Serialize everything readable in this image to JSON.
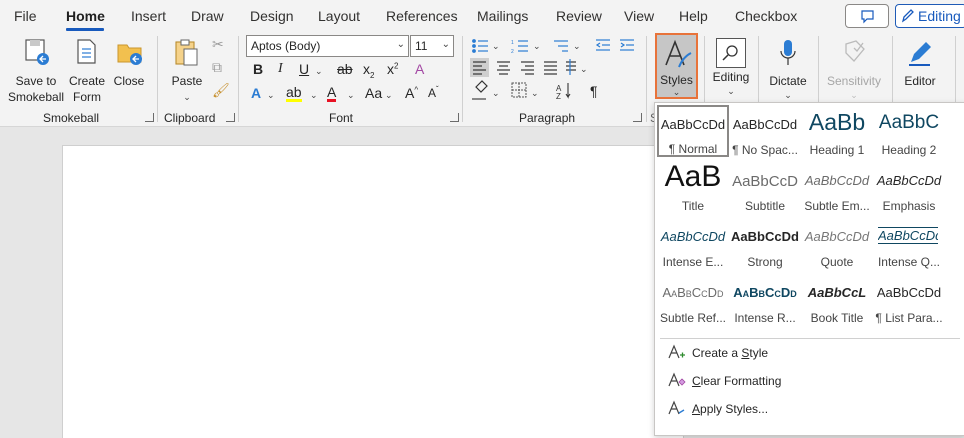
{
  "menu": {
    "tabs": [
      "File",
      "Home",
      "Insert",
      "Draw",
      "Design",
      "Layout",
      "References",
      "Mailings",
      "Review",
      "View",
      "Help",
      "Checkbox"
    ],
    "active_tab": "Home",
    "editing_button": "Editing"
  },
  "ribbon": {
    "smokeball": {
      "group_label": "Smokeball",
      "save_line1": "Save to",
      "save_line2": "Smokeball",
      "create_line1": "Create",
      "create_line2": "Form",
      "close": "Close"
    },
    "clipboard": {
      "group_label": "Clipboard",
      "paste": "Paste"
    },
    "font": {
      "group_label": "Font",
      "font_name": "Aptos (Body)",
      "font_size": "11",
      "bold": "B",
      "italic": "I",
      "underline": "U",
      "strike": "ab",
      "subscript": "x",
      "superscript": "x",
      "text_effects": "A",
      "highlight": "ab",
      "font_color": "A",
      "change_case": "Aa",
      "grow": "A",
      "shrink": "A"
    },
    "paragraph": {
      "group_label": "Paragraph",
      "show_marks": "¶"
    },
    "styles_label": "Styles",
    "editing_label": "Editing",
    "dictate_label": "Dictate",
    "sensitivity_label": "Sensitivity",
    "editor_label": "Editor"
  },
  "gallery": {
    "styles": [
      {
        "preview": "AaBbCcDd",
        "name": "¶ Normal"
      },
      {
        "preview": "AaBbCcDd",
        "name": "¶ No Spac..."
      },
      {
        "preview": "AaBb",
        "name": "Heading 1"
      },
      {
        "preview": "AaBbC",
        "name": "Heading 2"
      },
      {
        "preview": "AaB",
        "name": "Title"
      },
      {
        "preview": "AaBbCcD",
        "name": "Subtitle"
      },
      {
        "preview": "AaBbCcDd",
        "name": "Subtle Em..."
      },
      {
        "preview": "AaBbCcDd",
        "name": "Emphasis"
      },
      {
        "preview": "AaBbCcDd",
        "name": "Intense E..."
      },
      {
        "preview": "AaBbCcDd",
        "name": "Strong"
      },
      {
        "preview": "AaBbCcDd",
        "name": "Quote"
      },
      {
        "preview": "AaBbCcDd",
        "name": "Intense Q..."
      },
      {
        "preview": "AaBbCcDd",
        "name": "Subtle Ref..."
      },
      {
        "preview": "AaBbCcDd",
        "name": "Intense R..."
      },
      {
        "preview": "AaBbCcL",
        "name": "Book Title"
      },
      {
        "preview": "AaBbCcDd",
        "name": "¶ List Para..."
      }
    ],
    "commands": {
      "create_pre": "Create a ",
      "create_u": "S",
      "create_post": "tyle",
      "clear_u": "C",
      "clear_post": "lear Formatting",
      "apply_u": "A",
      "apply_post": "pply Styles..."
    }
  },
  "colors": {
    "accent": "#185abd",
    "highlight_border": "#e8733a",
    "heading": "#0f4761"
  }
}
